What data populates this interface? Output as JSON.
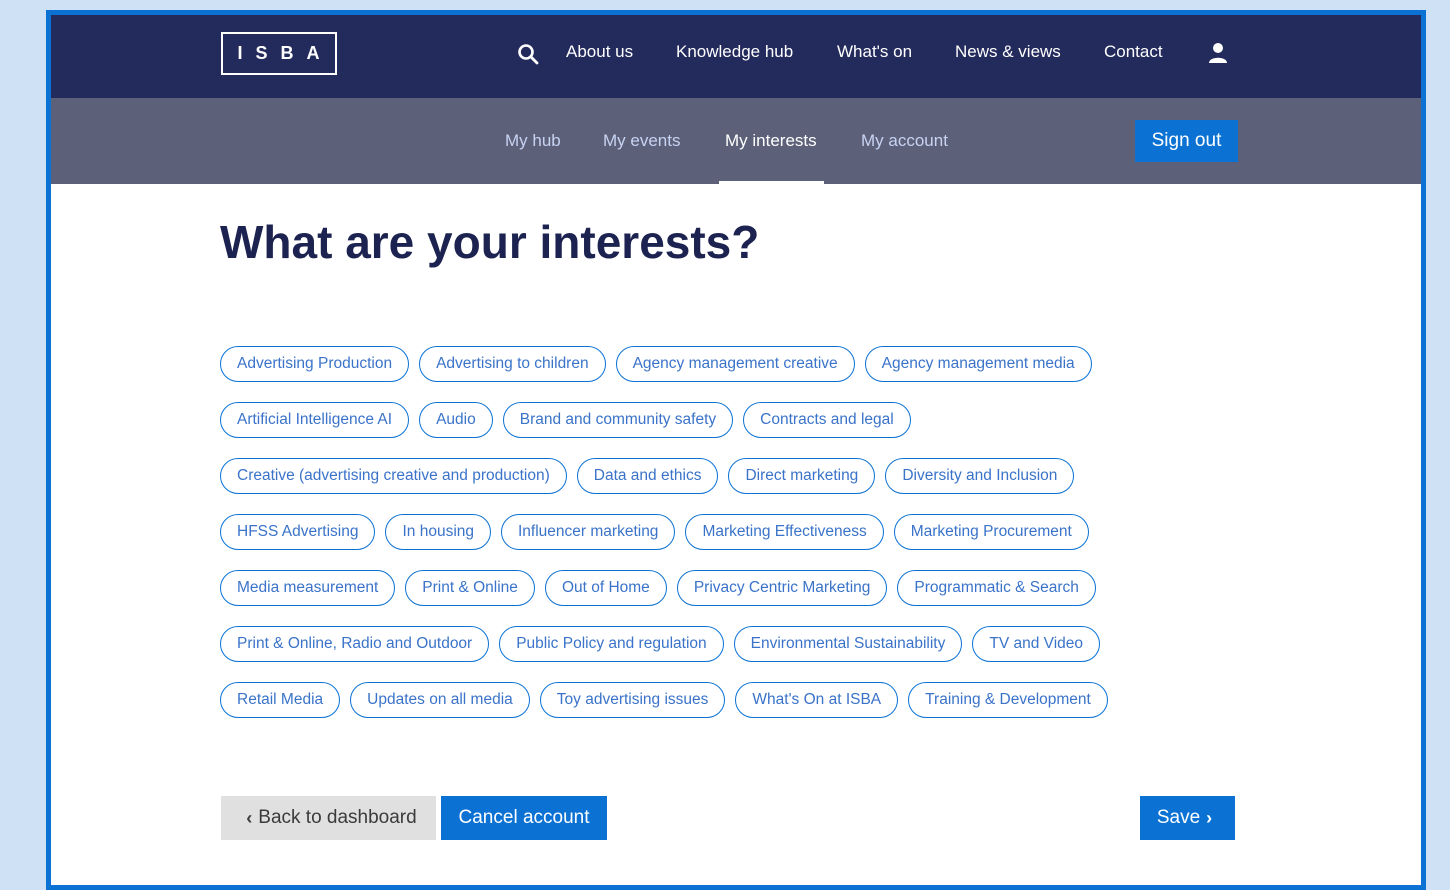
{
  "brand": {
    "logo_text": "ISBA"
  },
  "topnav": {
    "search_icon": "search-icon",
    "links": [
      "About us",
      "Knowledge hub",
      "What's on",
      "News & views",
      "Contact"
    ],
    "user_icon": "user-icon"
  },
  "subnav": {
    "links": [
      "My hub",
      "My events",
      "My interests",
      "My account"
    ],
    "active": "My interests",
    "sign_out": "Sign out"
  },
  "main": {
    "title": "What are your interests?",
    "interests": [
      "Advertising Production",
      "Advertising to children",
      "Agency management creative",
      "Agency management media",
      "Artificial Intelligence AI",
      "Audio",
      "Brand and community safety",
      "Contracts and legal",
      "Creative (advertising creative and production)",
      "Data and ethics",
      "Direct marketing",
      "Diversity and Inclusion",
      "HFSS Advertising",
      "In housing",
      "Influencer marketing",
      "Marketing Effectiveness",
      "Marketing Procurement",
      "Media measurement",
      "Print & Online",
      "Out of Home",
      "Privacy Centric Marketing",
      "Programmatic & Search",
      "Print & Online, Radio and Outdoor",
      "Public Policy and regulation",
      "Environmental Sustainability",
      "TV and Video",
      "Retail Media",
      "Updates on all media",
      "Toy advertising issues",
      "What's On at ISBA",
      "Training & Development"
    ]
  },
  "actions": {
    "back": "Back to dashboard",
    "cancel": "Cancel account",
    "save": "Save"
  },
  "colors": {
    "navy": "#232a5c",
    "subnav": "#5c6078",
    "accent": "#0b72d4",
    "frame": "#cfe2f5"
  }
}
